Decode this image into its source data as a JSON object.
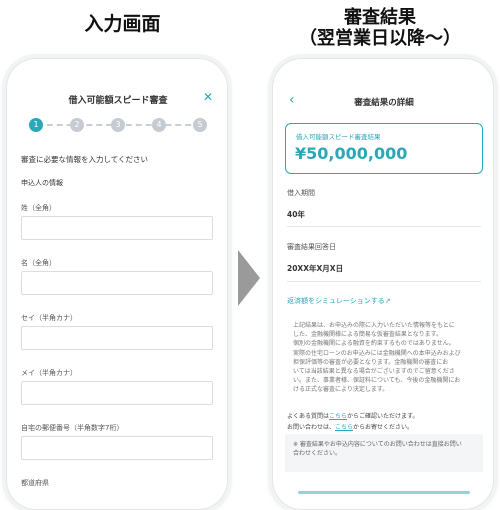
{
  "left": {
    "heading": "入力画面",
    "title": "借入可能額スピード審査",
    "steps": [
      "1",
      "2",
      "3",
      "4",
      "5"
    ],
    "instruction": "審査に必要な情報を入力してください",
    "section": "申込人の情報",
    "fields": [
      "姓（全角）",
      "名（全角）",
      "セイ（半角カナ）",
      "メイ（半角カナ）",
      "自宅の郵便番号（半角数字7桁）",
      "都道府県"
    ]
  },
  "right": {
    "heading_line1": "審査結果",
    "heading_line2": "（翌営業日以降〜）",
    "title": "審査結果の詳細",
    "card_label": "借入可能額スピード審査結果",
    "card_value": "¥50,000,000",
    "period_label": "借入期間",
    "period_value": "40年",
    "date_label": "審査結果回答日",
    "date_value": "20XX年X月X日",
    "sim_link": "返済額をシミュレーションする↗",
    "notes": [
      "上記結果は、お申込みの際に入力いただいた情報等をもとに",
      "した、金融機関様による簡易な仮審査結果となります。",
      "個別の金融機関による融資を約束するものではありません。",
      "実際の住宅ローンのお申込みには金融機関への本申込みおよび",
      "担保評価等の審査が必要となります。金融機関の審査にお",
      "いては当該結果と異なる場合がございますのでご留意くださ",
      "い。また、事業者様、保証料についても、今後の金融機関にお",
      "ける正式な審査により決定します。"
    ],
    "faq_pre": "よくある質問は",
    "faq_link": "こちら",
    "faq_post": "からご確認いただけます。",
    "contact_pre": "お問い合わせは、",
    "contact_link": "こちら",
    "contact_post": "からお寄せください。",
    "box_line1": "※ 審査結果やお申込内容についてのお問い合わせは直接お問い",
    "box_line2": "合わせください。"
  }
}
